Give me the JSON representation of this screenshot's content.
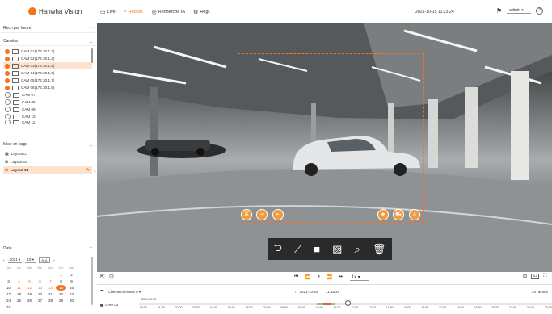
{
  "brand": {
    "name": "Hanwha Vision",
    "accent": "#f37321"
  },
  "nav": [
    {
      "label": "Live",
      "icon": "monitor-icon"
    },
    {
      "label": "Recher.",
      "icon": "search-icon",
      "active": true
    },
    {
      "label": "Recherche IA",
      "icon": "ai-search-icon"
    },
    {
      "label": "Régl.",
      "icon": "gear-icon"
    }
  ],
  "datetime": "2021-10-15 11:23:24",
  "user": "admin",
  "sidebar": {
    "search_mode": "Rech par heure",
    "camera_header": "Caméra",
    "cameras": [
      {
        "label": "CAM 01(172.30.1.3)",
        "state": "rec"
      },
      {
        "label": "CAM 02(172.30.1.4)",
        "state": "rec"
      },
      {
        "label": "CAM 03(172.30.1.5)",
        "state": "rec",
        "selected": true
      },
      {
        "label": "CAM 04(172.30.1.6)",
        "state": "rec"
      },
      {
        "label": "CAM 05(172.30.1.7)",
        "state": "rec"
      },
      {
        "label": "CAM 06(172.30.1.8)",
        "state": "rec"
      },
      {
        "label": "CAM 07",
        "state": "off"
      },
      {
        "label": "CAM 08",
        "state": "off"
      },
      {
        "label": "CAM 09",
        "state": "off"
      },
      {
        "label": "CAM 10",
        "state": "off"
      },
      {
        "label": "CAM 11",
        "state": "off"
      }
    ],
    "layout_header": "Mise en page",
    "layouts": [
      {
        "label": "Layout 01"
      },
      {
        "label": "Layout 02"
      },
      {
        "label": "Layout 03",
        "selected": true
      }
    ],
    "date_header": "Date",
    "calendar": {
      "year": "2021",
      "month": "10",
      "today_button": "Auj.",
      "weekdays": [
        "Dim",
        "Lun",
        "Mar",
        "Mer",
        "Jeu",
        "Ven",
        "Sam"
      ],
      "cells": [
        "",
        "",
        "",
        "",
        "",
        "1",
        "2",
        "3",
        "4",
        "5",
        "6",
        "7",
        "8",
        "9",
        "10",
        "11",
        "12",
        "13",
        "14",
        "15",
        "16",
        "17",
        "18",
        "19",
        "20",
        "21",
        "22",
        "23",
        "24",
        "25",
        "26",
        "27",
        "28",
        "29",
        "30",
        "31"
      ],
      "recorded_days": [
        "4",
        "5",
        "6",
        "7",
        "11",
        "12",
        "13",
        "14"
      ],
      "today": "15"
    }
  },
  "playback": {
    "speed": "1x",
    "date": "2021-10-15",
    "time": "11:18:20",
    "range": "24 heures",
    "overlap": "Chevauchement 0",
    "cursor_date": "2021.10.15",
    "track_label": "CAM 03",
    "hours": [
      "00:00",
      "01:00",
      "02:00",
      "03:00",
      "04:00",
      "05:00",
      "06:00",
      "07:00",
      "08:00",
      "09:00",
      "10:00",
      "11:00",
      "12:00",
      "13:00",
      "14:00",
      "15:00",
      "16:00",
      "17:00",
      "18:00",
      "19:00",
      "20:00",
      "21:00",
      "22:00",
      "23:00"
    ]
  },
  "overlay_tools": [
    "undo-icon",
    "line-icon",
    "square-icon",
    "area-icon",
    "zoom-icon",
    "delete-icon"
  ],
  "video_actions_left": [
    "ai-object-icon",
    "entry-icon",
    "exit-icon"
  ],
  "video_actions_right": [
    "person-icon",
    "vehicle-icon",
    "auto-icon"
  ]
}
